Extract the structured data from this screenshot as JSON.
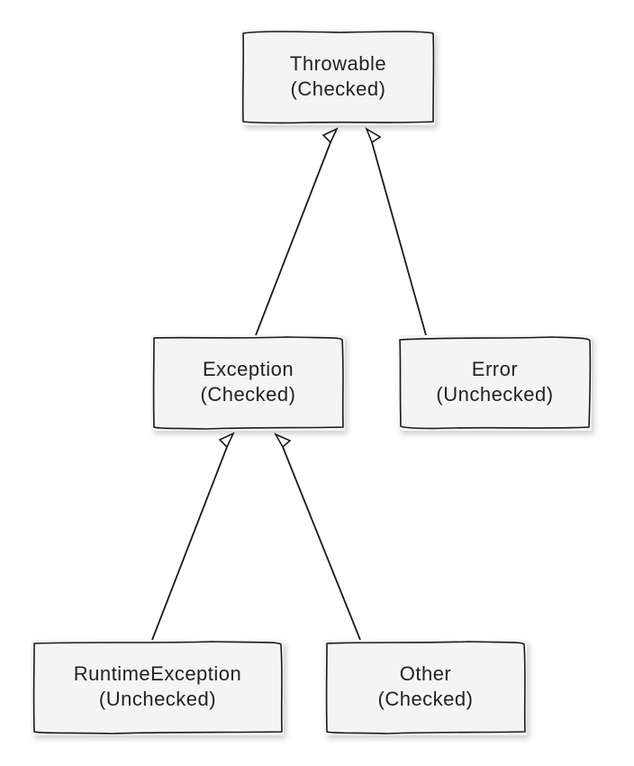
{
  "nodes": {
    "throwable": {
      "title": "Throwable",
      "sub": "(Checked)"
    },
    "exception": {
      "title": "Exception",
      "sub": "(Checked)"
    },
    "error": {
      "title": "Error",
      "sub": "(Unchecked)"
    },
    "runtime": {
      "title": "RuntimeException",
      "sub": "(Unchecked)"
    },
    "other": {
      "title": "Other",
      "sub": "(Checked)"
    }
  }
}
